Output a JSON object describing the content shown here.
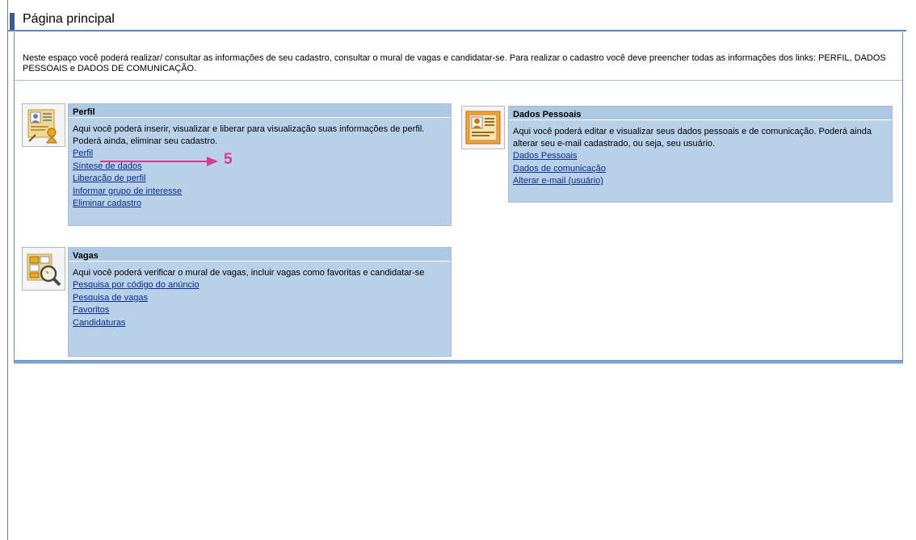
{
  "page": {
    "title": "Página principal",
    "intro": "Neste espaço você poderá realizar/ consultar as informações de seu cadastro, consultar o mural de vagas e candidatar-se. Para realizar o cadastro você deve preencher todas as informações dos links: PERFIL, DADOS PESSOAIS e DADOS DE COMUNICAÇÃO."
  },
  "cards": {
    "perfil": {
      "title": "Perfil",
      "description": "Aqui você poderá inserir, visualizar e liberar para visualização suas informações de perfil. Poderá ainda, eliminar seu cadastro.",
      "links": [
        "Perfil",
        "Síntese de dados",
        "Liberação de perfil",
        "Informar grupo de interesse",
        "Eliminar cadastro"
      ],
      "icon": "profile-card-icon"
    },
    "dados": {
      "title": "Dados Pessoais",
      "description": "Aqui você poderá editar e visualizar seus dados pessoais e de comunicação. Poderá ainda alterar seu e-mail cadastrado, ou seja, seu usuário.",
      "links": [
        "Dados Pessoais",
        "Dados de comunicação",
        "Alterar e-mail (usuário)"
      ],
      "icon": "id-card-icon"
    },
    "vagas": {
      "title": "Vagas",
      "description": "Aqui você poderá verificar o mural de vagas, incluir vagas como favoritas e candidatar-se",
      "links": [
        "Pesquisa por código do anúncio",
        "Pesquisa de vagas",
        "Favoritos",
        "Candidaturas"
      ],
      "icon": "job-search-icon"
    }
  },
  "annotation": {
    "step": "5",
    "color": "#d63b93"
  }
}
